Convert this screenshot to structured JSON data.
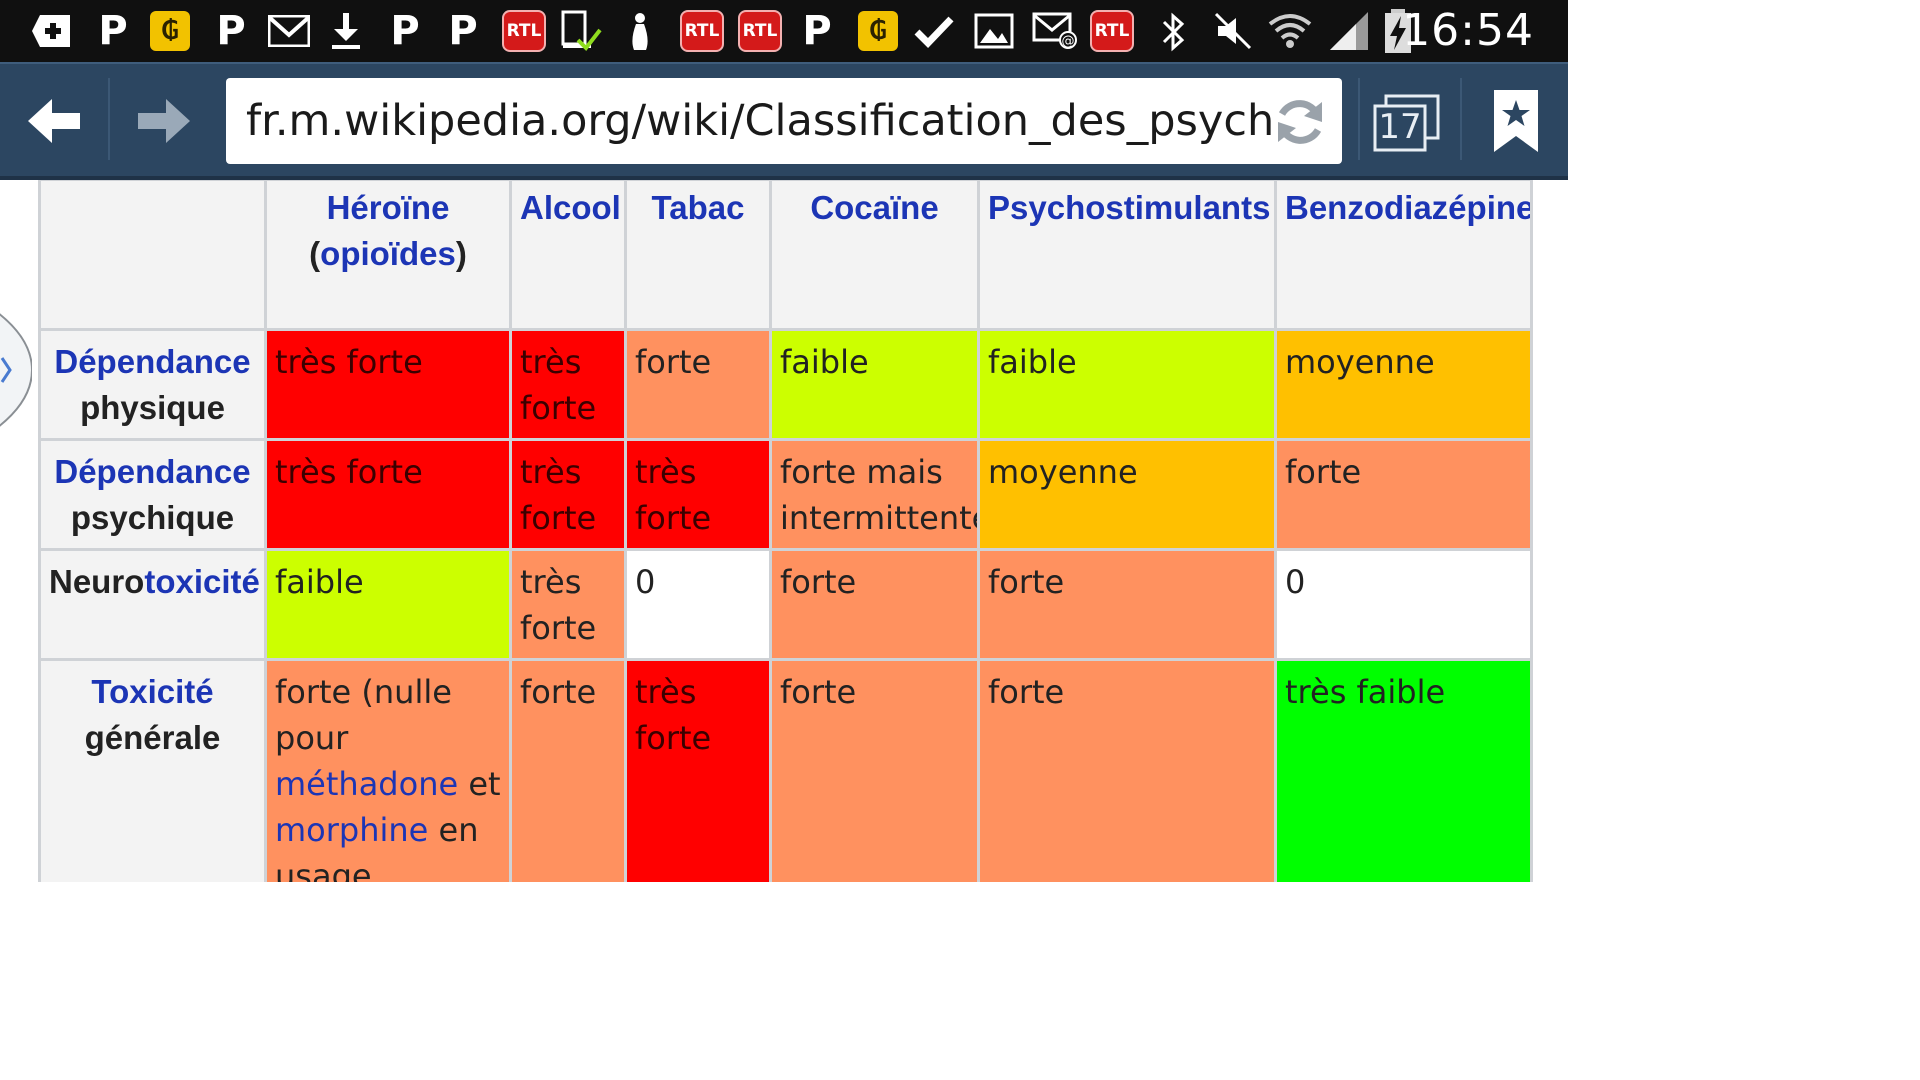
{
  "status_bar": {
    "icons_left": [
      {
        "name": "add-notification-icon"
      },
      {
        "name": "p-app-icon",
        "text": "P"
      },
      {
        "name": "coin-app-icon",
        "text": "₲"
      },
      {
        "name": "p-app-icon-2",
        "text": "P"
      },
      {
        "name": "gmail-icon"
      },
      {
        "name": "download-icon"
      },
      {
        "name": "p-app-icon-3",
        "text": "P"
      },
      {
        "name": "p-app-icon-4",
        "text": "P"
      },
      {
        "name": "rtl-icon",
        "text": "RTL"
      },
      {
        "name": "device-check-icon"
      },
      {
        "name": "bowling-pin-icon"
      },
      {
        "name": "rtl-icon-2",
        "text": "RTL"
      },
      {
        "name": "rtl-icon-3",
        "text": "RTL"
      },
      {
        "name": "p-app-icon-5",
        "text": "P"
      },
      {
        "name": "coin-app-icon-2",
        "text": "₲"
      },
      {
        "name": "checkmark-icon"
      },
      {
        "name": "image-icon"
      },
      {
        "name": "email-icon"
      },
      {
        "name": "rtl-icon-4",
        "text": "RTL"
      }
    ],
    "icons_right": [
      "bluetooth-icon",
      "mute-icon",
      "wifi-icon",
      "signal-icon",
      "battery-charging-icon"
    ],
    "clock": "16:54"
  },
  "browser": {
    "url": "fr.m.wikipedia.org/wiki/Classification_des_psychotropes",
    "tab_count": "17",
    "colors": {
      "toolbar": "#2c4661",
      "statusbar": "#101010"
    }
  },
  "table": {
    "columns": [
      {
        "parts": [
          {
            "t": "Héroïne",
            "link": true
          },
          {
            "br": true
          },
          {
            "t": "(",
            "link": false
          },
          {
            "t": "opioïdes",
            "link": true
          },
          {
            "t": ")",
            "link": false
          }
        ]
      },
      {
        "parts": [
          {
            "t": "Alcool",
            "link": true
          }
        ]
      },
      {
        "parts": [
          {
            "t": "Tabac",
            "link": true
          }
        ]
      },
      {
        "parts": [
          {
            "t": "Cocaïne",
            "link": true
          }
        ]
      },
      {
        "parts": [
          {
            "t": "Psychostimulants",
            "link": true
          }
        ]
      },
      {
        "parts": [
          {
            "t": "Benzodiazépines",
            "link": true
          }
        ]
      }
    ],
    "rows": [
      {
        "header": [
          {
            "t": "Dépendance",
            "link": true
          },
          {
            "br": true
          },
          {
            "t": "physique",
            "link": false
          }
        ],
        "cells": [
          {
            "color": "red",
            "parts": [
              {
                "t": "très forte"
              }
            ]
          },
          {
            "color": "red",
            "parts": [
              {
                "t": "très forte"
              }
            ]
          },
          {
            "color": "salmon",
            "parts": [
              {
                "t": "forte"
              }
            ]
          },
          {
            "color": "lime",
            "parts": [
              {
                "t": "faible"
              }
            ]
          },
          {
            "color": "lime",
            "parts": [
              {
                "t": "faible"
              }
            ]
          },
          {
            "color": "amber",
            "parts": [
              {
                "t": "moyenne"
              }
            ]
          }
        ]
      },
      {
        "header": [
          {
            "t": "Dépendance",
            "link": true
          },
          {
            "br": true
          },
          {
            "t": "psychique",
            "link": false
          }
        ],
        "cells": [
          {
            "color": "red",
            "parts": [
              {
                "t": "très forte"
              }
            ]
          },
          {
            "color": "red",
            "parts": [
              {
                "t": "très forte"
              }
            ]
          },
          {
            "color": "red",
            "parts": [
              {
                "t": "très forte"
              }
            ]
          },
          {
            "color": "salmon",
            "parts": [
              {
                "t": "forte mais intermittente"
              }
            ]
          },
          {
            "color": "amber",
            "parts": [
              {
                "t": "moyenne"
              }
            ]
          },
          {
            "color": "salmon",
            "parts": [
              {
                "t": "forte"
              }
            ]
          }
        ]
      },
      {
        "header": [
          {
            "t": "Neuro",
            "link": false
          },
          {
            "t": "toxicité",
            "link": true
          }
        ],
        "cells": [
          {
            "color": "lime",
            "parts": [
              {
                "t": "faible"
              }
            ]
          },
          {
            "color": "salmon",
            "parts": [
              {
                "t": "très forte"
              }
            ]
          },
          {
            "color": "white",
            "parts": [
              {
                "t": "0"
              }
            ]
          },
          {
            "color": "salmon",
            "parts": [
              {
                "t": "forte"
              }
            ]
          },
          {
            "color": "salmon",
            "parts": [
              {
                "t": "forte"
              }
            ]
          },
          {
            "color": "white",
            "parts": [
              {
                "t": "0"
              }
            ]
          }
        ]
      },
      {
        "header": [
          {
            "t": "Toxicité",
            "link": true
          },
          {
            "br": true
          },
          {
            "t": "générale",
            "link": false
          }
        ],
        "cells": [
          {
            "color": "salmon",
            "parts": [
              {
                "t": "forte (nulle pour "
              },
              {
                "t": "méthadone",
                "link": true
              },
              {
                "t": " et "
              },
              {
                "t": "morphine",
                "link": true
              },
              {
                "t": " en usage"
              }
            ]
          },
          {
            "color": "salmon",
            "parts": [
              {
                "t": "forte"
              }
            ]
          },
          {
            "color": "red",
            "parts": [
              {
                "t": "très forte"
              }
            ]
          },
          {
            "color": "salmon",
            "parts": [
              {
                "t": "forte"
              }
            ]
          },
          {
            "color": "salmon",
            "parts": [
              {
                "t": "forte"
              }
            ]
          },
          {
            "color": "green",
            "parts": [
              {
                "t": "très faible"
              }
            ]
          }
        ]
      }
    ]
  }
}
